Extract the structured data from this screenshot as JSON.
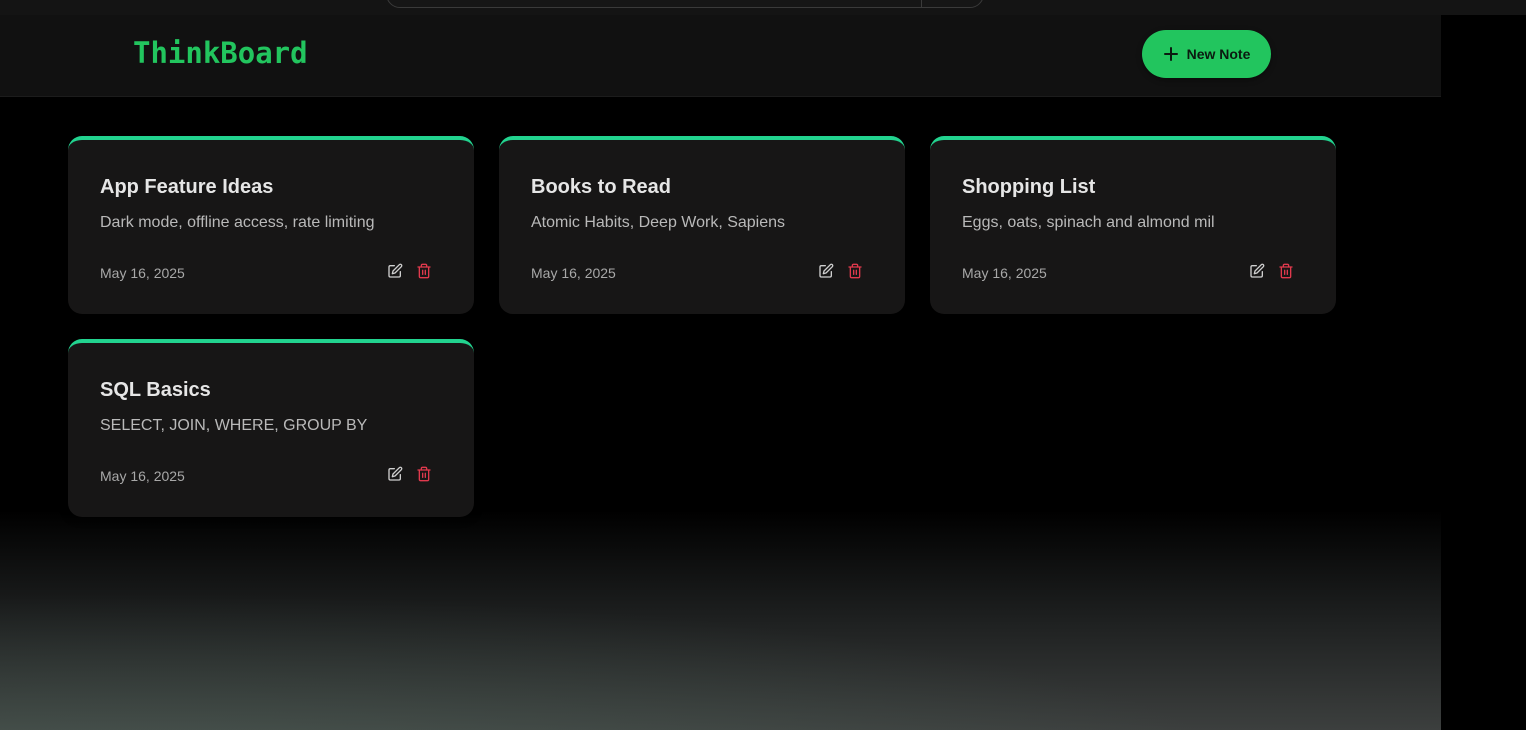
{
  "app": {
    "brand": "ThinkBoard"
  },
  "header": {
    "new_note_label": "New Note"
  },
  "notes": [
    {
      "title": "App Feature Ideas",
      "content": "Dark mode, offline access, rate limiting",
      "date": "May 16, 2025"
    },
    {
      "title": "Books to Read",
      "content": "Atomic Habits, Deep Work, Sapiens",
      "date": "May 16, 2025"
    },
    {
      "title": "Shopping List",
      "content": "Eggs, oats, spinach and almond mil",
      "date": "May 16, 2025"
    },
    {
      "title": "SQL Basics",
      "content": "SELECT, JOIN, WHERE, GROUP BY",
      "date": "May 16, 2025"
    }
  ],
  "colors": {
    "accent": "#22c55e",
    "card_border": "#22d38f",
    "delete": "#e0394d",
    "background": "#000000"
  },
  "icons": {
    "new_note": "plus-icon",
    "edit": "pen-square-icon",
    "delete": "trash-icon"
  }
}
